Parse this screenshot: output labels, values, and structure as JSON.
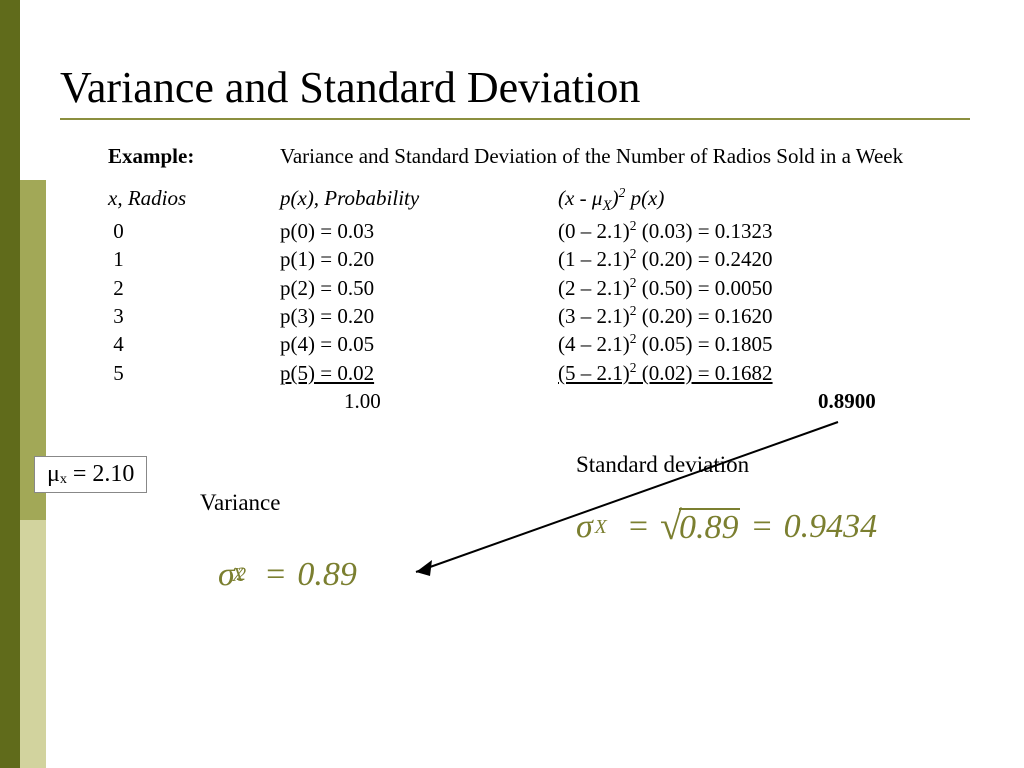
{
  "title": "Variance and Standard Deviation",
  "example_label": "Example",
  "example_desc": "Variance and Standard Deviation of the Number of Radios Sold in a Week",
  "columns": {
    "col1": "x, Radios",
    "col2": "p(x), Probability",
    "col3_prefix": "(x - ",
    "col3_mu": "μ",
    "col3_sub": "X",
    "col3_mid": ")",
    "col3_sup": "2",
    "col3_suffix": "  p(x)"
  },
  "rows": [
    {
      "x": "0",
      "p": "p(0) = 0.03",
      "calc": "(0 – 2.1)² (0.03) = 0.1323"
    },
    {
      "x": "1",
      "p": "p(1) = 0.20",
      "calc": "(1 – 2.1)² (0.20) = 0.2420"
    },
    {
      "x": "2",
      "p": "p(2) = 0.50",
      "calc": "(2 – 2.1)² (0.50) = 0.0050"
    },
    {
      "x": "3",
      "p": "p(3) = 0.20",
      "calc": "(3 – 2.1)² (0.20) = 0.1620"
    },
    {
      "x": "4",
      "p": "p(4) = 0.05",
      "calc": "(4 – 2.1)² (0.05) = 0.1805"
    },
    {
      "x": "5",
      "p": "p(5) = 0.02",
      "calc": "(5 – 2.1)² (0.02) = 0.1682"
    }
  ],
  "totals": {
    "prob": "1.00",
    "sumsq": "0.8900"
  },
  "mu_label": "μₓ = 2.10",
  "variance_label": "Variance",
  "sd_label": "Standard deviation",
  "formula_var": {
    "sigma": "σ",
    "sub": "X",
    "sup": "2",
    "eq": "=",
    "val": "0.89"
  },
  "formula_sd": {
    "sigma": "σ",
    "sub": "X",
    "eq1": "=",
    "rad": "0.89",
    "eq2": "=",
    "val": "0.9434"
  }
}
